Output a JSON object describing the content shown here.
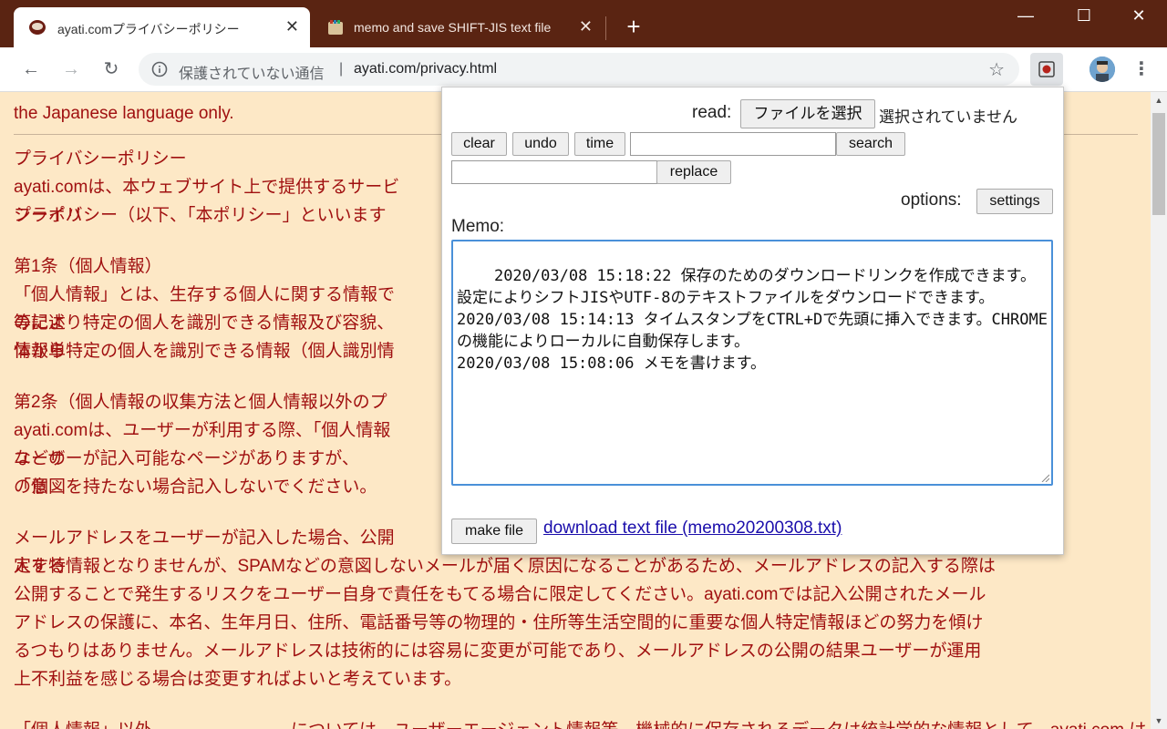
{
  "browser": {
    "tabs": [
      {
        "title": "ayati.comプライバシーポリシー",
        "close": "✕"
      },
      {
        "title": "memo and save SHIFT-JIS text file",
        "close": "✕"
      }
    ],
    "new_tab": "+",
    "window_controls": {
      "minimize": "—",
      "maximize": "☐",
      "close": "✕"
    },
    "nav": {
      "back": "←",
      "forward": "→",
      "reload": "↻"
    },
    "address": {
      "security": "保護されていない通信",
      "divider": "|",
      "url": "ayati.com/privacy.html",
      "star": "☆"
    },
    "menu": "⋮"
  },
  "page": {
    "top_text": "the Japanese language only.",
    "paragraphs": [
      "プライバシーポリシー",
      "ayati.comは、本ウェブサイト上で提供するサービ　　　　　　　　　　　　　　　　　　　　　　　　　　　　　　　　　　　　　　　　　　　プライバ",
      "シーポリシー（以下、「本ポリシー」といいます",
      "第1条（個人情報）",
      "「個人情報」とは、生存する個人に関する情報で　　　　　　　　　　　　　　　　　　　　　　　　　　　　　　　　　　　　　　　　　　　の記述",
      "等により特定の個人を識別できる情報及び容貌、　　　　　　　　　　　　　　　　　　　　　　　　　　　　　　　　　　　　　　　　　　　情報単",
      "体から特定の個人を識別できる情報（個人識別情",
      "第2条（個人情報の収集方法と個人情報以外のプ",
      "ayati.comは、ユーザーが利用する際、「個人情報　　　　　　　　　　　　　　　　　　　　　　　　　　　　　　　　　　　　　　　　　　　などの",
      "ユーザーが記入可能なページがありますが、「個　　　　　　　　　　　　　　　　　　　　　　　　　　　　　　　　　　　　　　　　　　　。公開",
      "の意図を持たない場合記入しないでください。",
      "メールアドレスをユーザーが記入した場合、公開　　　　　　　　　　　　　　　　　　　　　　　　　　　　　　　　　　　　　　　　　　　人を特",
      "定する情報となりませんが、SPAMなどの意図しないメールが届く原因になることがあるため、メールアドレスの記入する際は",
      "公開することで発生するリスクをユーザー自身で責任をもてる場合に限定してください。ayati.comでは記入公開されたメール",
      "アドレスの保護に、本名、生年月日、住所、電話番号等の物理的・住所等生活空間的に重要な個人特定情報ほどの努力を傾け",
      "るつもりはありません。メールアドレスは技術的には容易に変更が可能であり、メールアドレスの公開の結果ユーザーが運用",
      "上不利益を感じる場合は変更すればよいと考えています。",
      "「個人情報」以外　　　　　　　　については、ユーザーエージェント情報等、機械的に保存されるデータは統計学的な情報として、ayati.com は、手を加えた上で"
    ]
  },
  "popup": {
    "read_label": "read:",
    "file_button": "ファイルを選択",
    "file_status": "選択されていません",
    "clear": "clear",
    "undo": "undo",
    "time": "time",
    "search": "search",
    "replace": "replace",
    "options_label": "options:",
    "settings": "settings",
    "memo_label": "Memo:",
    "memo_text": "2020/03/08 15:18:22 保存のためのダウンロードリンクを作成できます。設定によりシフトJISやUTF-8のテキストファイルをダウンロードできます。\n2020/03/08 15:14:13 タイムスタンプをCTRL+Dで先頭に挿入できます。CHROMEの機能によりローカルに自動保存します。\n2020/03/08 15:08:06 メモを書けます。",
    "make_file": "make file",
    "download_link": "download text file (memo20200308.txt)"
  },
  "colors": {
    "titlebar": "#5a2412",
    "page_bg": "#fde8c6",
    "page_text": "#a01010",
    "link": "#1a0dab"
  }
}
